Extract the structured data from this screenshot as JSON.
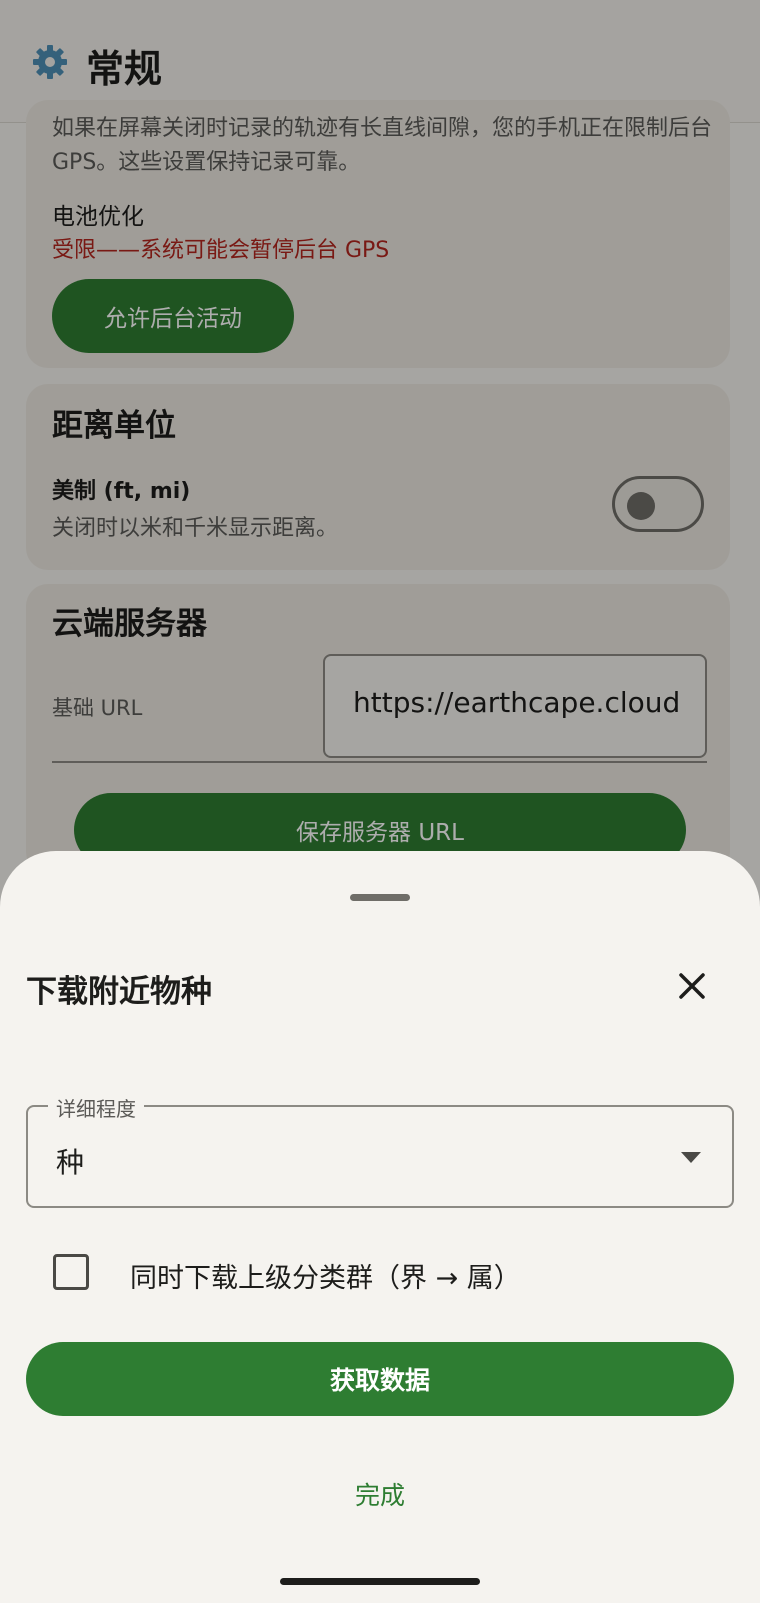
{
  "appbar": {
    "title": "常规",
    "icon": "gear-icon"
  },
  "gps_card": {
    "description": "如果在屏幕关闭时记录的轨迹有长直线间隙，您的手机正在限制后台 GPS。这些设置保持记录可靠。",
    "battery_label": "电池优化",
    "battery_status": "受限——系统可能会暂停后台 GPS",
    "allow_button": "允许后台活动"
  },
  "distance_card": {
    "title": "距离单位",
    "option_label": "美制 (ft, mi)",
    "option_desc": "关闭时以米和千米显示距离。",
    "toggle_on": false
  },
  "server_card": {
    "title": "云端服务器",
    "url_label": "基础 URL",
    "url_value": "https://earthcape.cloud",
    "save_button": "保存服务器 URL"
  },
  "sheet": {
    "title": "下载附近物种",
    "detail_label": "详细程度",
    "detail_value": "种",
    "checkbox_label": "同时下载上级分类群（界 → 属）",
    "checkbox_checked": false,
    "fetch_button": "获取数据",
    "done_button": "完成"
  },
  "colors": {
    "accent": "#2e7d32",
    "warning": "#b3261e",
    "background": "#f5f3ef"
  }
}
